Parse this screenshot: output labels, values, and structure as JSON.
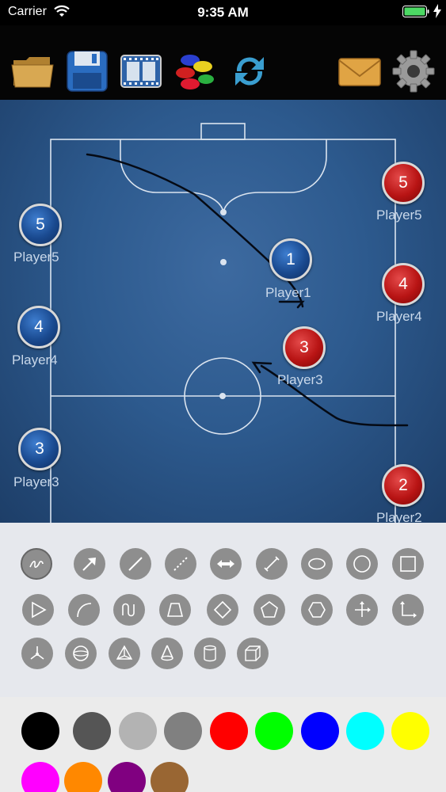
{
  "status_bar": {
    "carrier": "Carrier",
    "time": "9:35 AM"
  },
  "toolbar": {
    "buttons": [
      "folder-icon",
      "save-icon",
      "film-icon",
      "cones-icon",
      "refresh-icon",
      "mail-icon",
      "gear-icon"
    ]
  },
  "field": {
    "players": [
      {
        "number": "5",
        "label": "Player5",
        "team": "blue"
      },
      {
        "number": "4",
        "label": "Player4",
        "team": "blue"
      },
      {
        "number": "3",
        "label": "Player3",
        "team": "blue"
      },
      {
        "number": "1",
        "label": "Player1",
        "team": "blue"
      },
      {
        "number": "5",
        "label": "Player5",
        "team": "red"
      },
      {
        "number": "4",
        "label": "Player4",
        "team": "red"
      },
      {
        "number": "3",
        "label": "Player3",
        "team": "red"
      },
      {
        "number": "2",
        "label": "Player2",
        "team": "red"
      }
    ],
    "team_colors": {
      "blue": "#1a4a90",
      "red": "#b81414"
    }
  },
  "tools": {
    "row1": [
      "freehand-icon",
      "arrow-icon",
      "line-icon",
      "dashed-line-icon",
      "double-arrow-icon",
      "measure-line-icon",
      "ellipse-icon",
      "circle-icon",
      "square-icon"
    ],
    "row2": [
      "triangle-play-icon",
      "arc-icon",
      "zigzag-icon",
      "trapezoid-icon",
      "diamond-icon",
      "pentagon-icon",
      "hexagon-icon",
      "cross-arrows-icon",
      "corner-arrows-icon"
    ],
    "row3": [
      "axis-3d-icon",
      "sphere-icon",
      "pyramid-icon",
      "cone-icon",
      "cylinder-icon",
      "cube-icon"
    ]
  },
  "colors": {
    "row1": [
      "#000000",
      "#555555",
      "#b3b3b3",
      "#808080",
      "#ff0000",
      "#00ff00",
      "#0000ff",
      "#00ffff",
      "#ffff00"
    ],
    "row2": [
      "#ff00ff",
      "#ff8800",
      "#800080",
      "#996633"
    ]
  }
}
